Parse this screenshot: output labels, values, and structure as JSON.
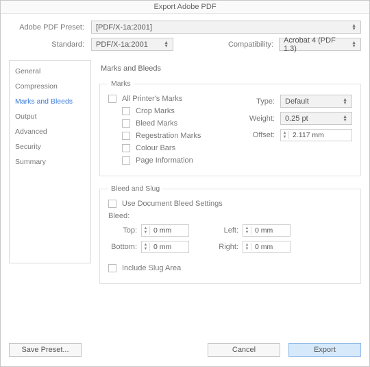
{
  "title": "Export Adobe PDF",
  "preset": {
    "label": "Adobe PDF Preset:",
    "value": "[PDF/X-1a:2001]"
  },
  "standard": {
    "label": "Standard:",
    "value": "PDF/X-1a:2001"
  },
  "compat": {
    "label": "Compatibility:",
    "value": "Acrobat 4 (PDF 1.3)"
  },
  "sidebar": {
    "items": [
      "General",
      "Compression",
      "Marks and Bleeds",
      "Output",
      "Advanced",
      "Security",
      "Summary"
    ],
    "selected_index": 2
  },
  "panel": {
    "title": "Marks and Bleeds",
    "marks": {
      "legend": "Marks",
      "all": "All Printer's Marks",
      "crop": "Crop Marks",
      "bleed_marks": "Bleed Marks",
      "registration": "Regestration Marks",
      "colour_bars": "Colour Bars",
      "page_info": "Page Information",
      "type": {
        "label": "Type:",
        "value": "Default"
      },
      "weight": {
        "label": "Weight:",
        "value": "0.25 pt"
      },
      "offset": {
        "label": "Offset:",
        "value": "2.117 mm"
      }
    },
    "bleedslug": {
      "legend": "Bleed and Slug",
      "use_doc": "Use Document Bleed Settings",
      "bleed_label": "Bleed:",
      "top": {
        "label": "Top:",
        "value": "0 mm"
      },
      "bottom": {
        "label": "Bottom:",
        "value": "0 mm"
      },
      "left": {
        "label": "Left:",
        "value": "0 mm"
      },
      "right": {
        "label": "Right:",
        "value": "0 mm"
      },
      "include_slug": "Include Slug Area"
    }
  },
  "footer": {
    "save_preset": "Save Preset...",
    "cancel": "Cancel",
    "export": "Export"
  }
}
